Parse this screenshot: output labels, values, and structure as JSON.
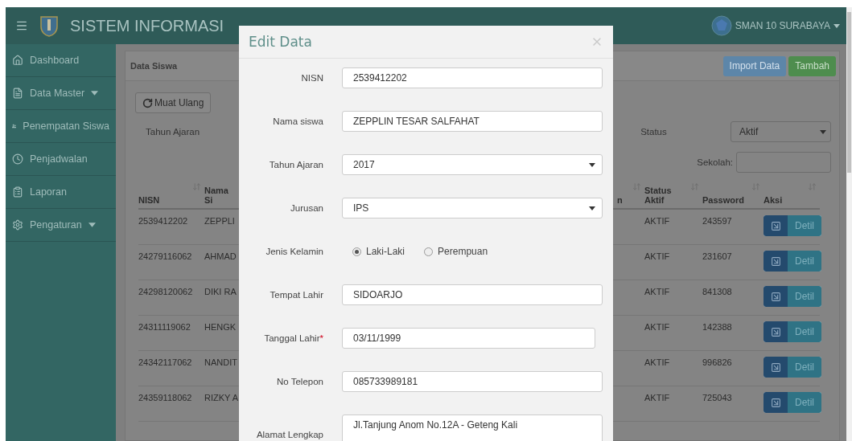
{
  "header": {
    "title": "SISTEM INFORMASI",
    "school": "SMAN 10 SURABAYA"
  },
  "sidebar": [
    {
      "label": "Dashboard",
      "has_caret": false
    },
    {
      "label": "Data Master",
      "has_caret": true
    },
    {
      "label": "Penempatan Siswa",
      "has_caret": false
    },
    {
      "label": "Penjadwalan",
      "has_caret": false
    },
    {
      "label": "Laporan",
      "has_caret": false
    },
    {
      "label": "Pengaturan",
      "has_caret": true
    }
  ],
  "panel": {
    "title": "Data Siswa",
    "buttons": [
      {
        "label": "Import Data",
        "kind": "primary"
      },
      {
        "label": "Tambah",
        "kind": "success"
      }
    ],
    "reload_button": "Muat Ulang",
    "filters": {
      "year_label": "Tahun Ajaran",
      "status_label": "Status",
      "status_value": "Aktif",
      "school_label": "Sekolah:"
    }
  },
  "table": {
    "columns": [
      "NISN",
      "Nama Si",
      "n",
      "Status Aktif",
      "Password",
      "Aksi"
    ],
    "rows": [
      {
        "nisn": "2539412202",
        "name": "ZEPPLI",
        "status": "AKTIF",
        "password": "243597",
        "action": "Detil"
      },
      {
        "nisn": "24279116062",
        "name": "AHMAD",
        "status": "AKTIF",
        "password": "231607",
        "action": "Detil"
      },
      {
        "nisn": "24298120062",
        "name": "DIKI RA",
        "status": "AKTIF",
        "password": "841308",
        "action": "Detil"
      },
      {
        "nisn": "24311119062",
        "name": "HENGK",
        "status": "AKTIF",
        "password": "142388",
        "action": "Detil"
      },
      {
        "nisn": "24342117062",
        "name": "NANDIT",
        "status": "AKTIF",
        "password": "996826",
        "action": "Detil"
      },
      {
        "nisn": "24359118062",
        "name": "RIZKY A",
        "status": "AKTIF",
        "password": "725043",
        "action": "Detil"
      }
    ]
  },
  "modal": {
    "title": "Edit Data",
    "fields": [
      {
        "kind": "text",
        "label": "NISN",
        "value": "2539412202"
      },
      {
        "kind": "text",
        "label": "Nama siswa",
        "value": "ZEPPLIN TESAR SALFAHAT"
      },
      {
        "kind": "select",
        "label": "Tahun Ajaran",
        "value": "2017"
      },
      {
        "kind": "select",
        "label": "Jurusan",
        "value": "IPS"
      },
      {
        "kind": "radio",
        "label": "Jenis Kelamin",
        "options": [
          {
            "label": "Laki-Laki",
            "selected": true
          },
          {
            "label": "Perempuan",
            "selected": false
          }
        ]
      },
      {
        "kind": "text",
        "label": "Tempat Lahir",
        "value": "SIDOARJO"
      },
      {
        "kind": "date",
        "label": "Tanggal Lahir",
        "value": "03/11/1999",
        "required_mark": "*"
      },
      {
        "kind": "text",
        "label": "No Telepon",
        "value": "085733989181"
      },
      {
        "kind": "textarea",
        "label": "Alamat Lengkap",
        "value": "Jl.Tanjung Anom No.12A - Geteng Kali"
      }
    ]
  }
}
